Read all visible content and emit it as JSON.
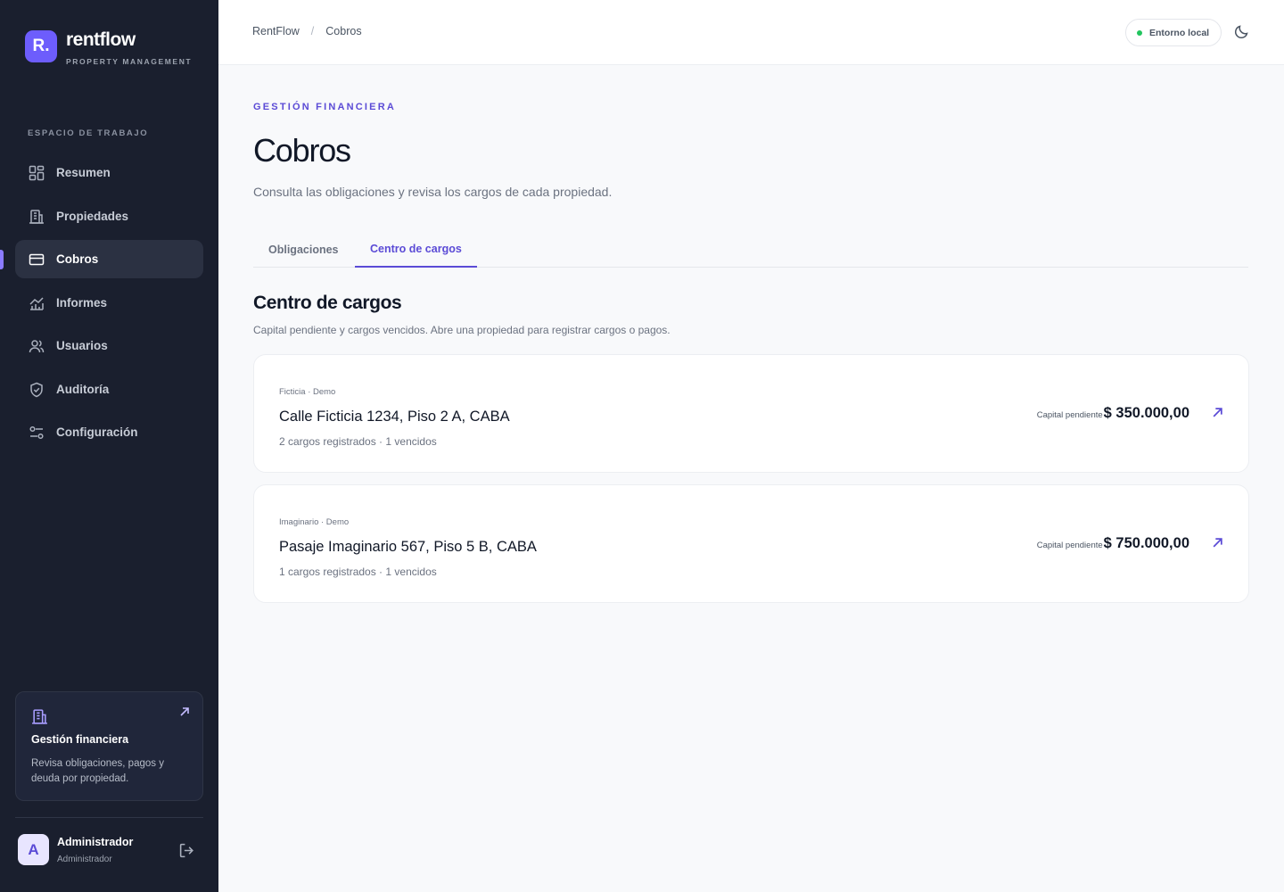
{
  "brand": {
    "logo": "R.",
    "name": "rentflow",
    "subtitle": "PROPERTY MANAGEMENT"
  },
  "sidebar": {
    "section_label": "ESPACIO DE TRABAJO",
    "items": [
      {
        "label": "Resumen",
        "icon": "dashboard-icon"
      },
      {
        "label": "Propiedades",
        "icon": "building-icon"
      },
      {
        "label": "Cobros",
        "icon": "credit-card-icon",
        "active": true
      },
      {
        "label": "Informes",
        "icon": "chart-icon"
      },
      {
        "label": "Usuarios",
        "icon": "users-icon"
      },
      {
        "label": "Auditoría",
        "icon": "shield-icon"
      },
      {
        "label": "Configuración",
        "icon": "sliders-icon"
      }
    ],
    "promo": {
      "title": "Gestión financiera",
      "text": "Revisa obligaciones, pagos y deuda por propiedad."
    },
    "user": {
      "initial": "A",
      "name": "Administrador",
      "role": "Administrador"
    }
  },
  "topbar": {
    "breadcrumb": [
      "RentFlow",
      "Cobros"
    ],
    "breadcrumb_separator": "/",
    "env_badge": "Entorno local"
  },
  "main": {
    "eyebrow": "GESTIÓN FINANCIERA",
    "title": "Cobros",
    "subtitle": "Consulta las obligaciones y revisa los cargos de cada propiedad.",
    "tabs": [
      {
        "label": "Obligaciones",
        "active": false
      },
      {
        "label": "Centro de cargos",
        "active": true
      }
    ],
    "section_title": "Centro de cargos",
    "section_subtitle": "Capital pendiente y cargos vencidos. Abre una propiedad para registrar cargos o pagos.",
    "cards": [
      {
        "tag": "Ficticia · Demo",
        "title": "Calle Ficticia 1234, Piso 2 A, CABA",
        "meta": "2 cargos registrados · 1 vencidos",
        "amount_label": "Capital pendiente",
        "amount": "$ 350.000,00"
      },
      {
        "tag": "Imaginario · Demo",
        "title": "Pasaje Imaginario 567, Piso 5 B, CABA",
        "meta": "1 cargos registrados · 1 vencidos",
        "amount_label": "Capital pendiente",
        "amount": "$ 750.000,00"
      }
    ]
  },
  "colors": {
    "sidebar_bg": "#1a1f2e",
    "accent": "#5b4bd6",
    "accent_light": "#6d5dfc",
    "status_ok": "#22c55e"
  }
}
